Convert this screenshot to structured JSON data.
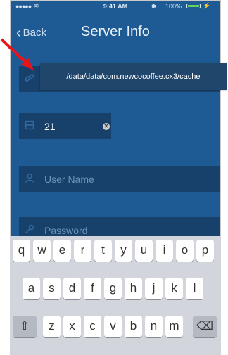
{
  "status_bar": {
    "signal": "●●●●●",
    "wifi": "≋",
    "time": "9:41 AM",
    "bluetooth": "✱",
    "battery_percent": "100%",
    "charge": "⚡",
    "battery_level": 1.0
  },
  "nav": {
    "back_label": "Back",
    "title": "Server Info"
  },
  "form": {
    "path_field": {
      "icon": "link-icon",
      "value": ""
    },
    "tooltip_text": "/data/data/com.newcocoffee.cx3/cache",
    "port_field": {
      "icon": "server-icon",
      "value": "21"
    },
    "username_field": {
      "icon": "user-icon",
      "placeholder": "User Name"
    },
    "password_field": {
      "icon": "key-icon",
      "placeholder": "Password"
    }
  },
  "keyboard": {
    "row1": [
      "q",
      "w",
      "e",
      "r",
      "t",
      "y",
      "u",
      "i",
      "o",
      "p"
    ],
    "row2": [
      "a",
      "s",
      "d",
      "f",
      "g",
      "h",
      "j",
      "k",
      "l"
    ],
    "row3": [
      "z",
      "x",
      "c",
      "v",
      "b",
      "n",
      "m"
    ],
    "shift_icon": "shift-icon",
    "delete_icon": "delete-icon"
  },
  "colors": {
    "background": "#1e5a93",
    "field": "#17406a",
    "tooltip": "#20466b",
    "arrow": "#e8141c"
  }
}
